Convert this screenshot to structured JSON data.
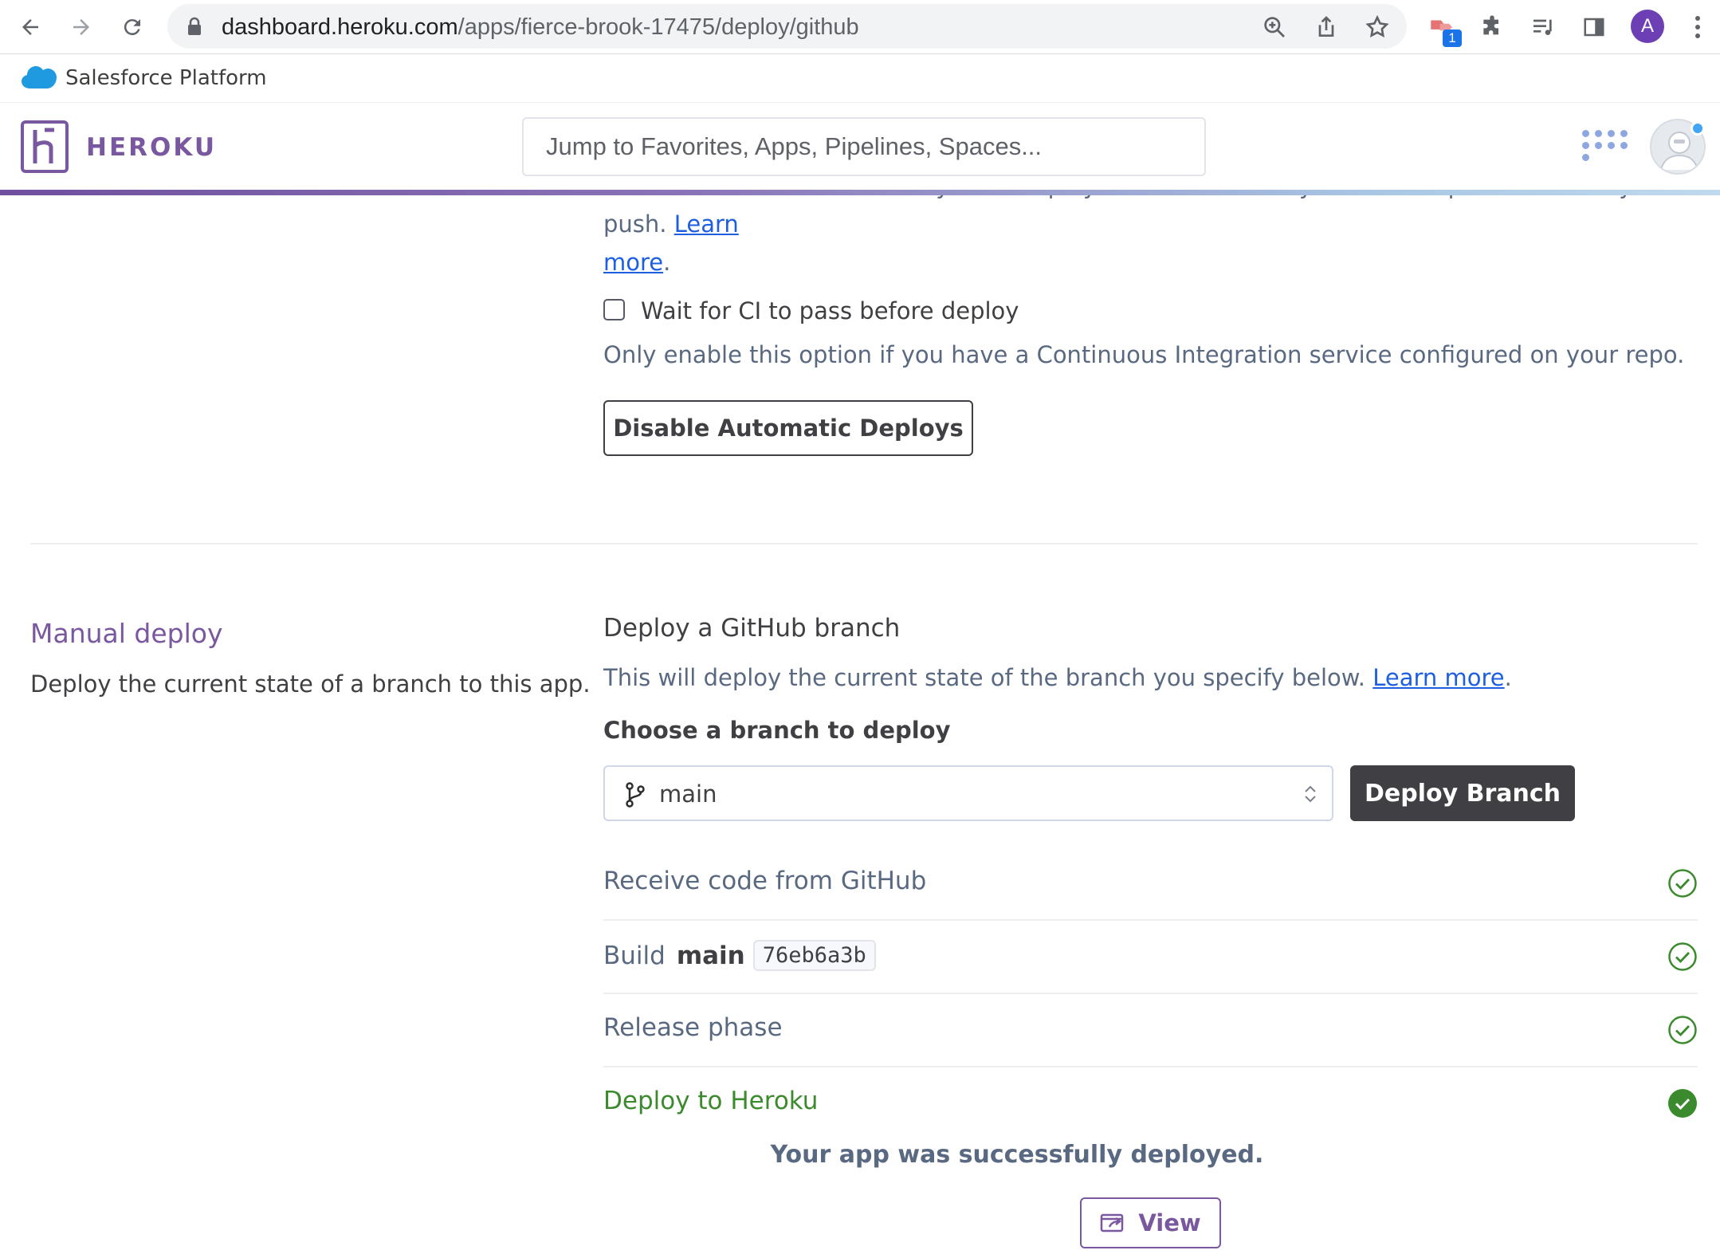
{
  "browser": {
    "url_host": "dashboard.heroku.com",
    "url_path": "/apps/fierce-brook-17475/deploy/github",
    "extension_badge": "1",
    "profile_initial": "A"
  },
  "platform_bar": {
    "label": "Salesforce Platform"
  },
  "header": {
    "brand": "HEROKU",
    "search_placeholder": "Jump to Favorites, Apps, Pipelines, Spaces..."
  },
  "auto_deploy": {
    "partial_text": "this branch in GitHub is always in a deployable state and any tests have passed before you push.",
    "learn_more_1": "Learn",
    "learn_more_2": "more",
    "period": ".",
    "ci_checkbox_label": "Wait for CI to pass before deploy",
    "ci_checked": false,
    "ci_help": "Only enable this option if you have a Continuous Integration service configured on your repo.",
    "disable_button": "Disable Automatic Deploys"
  },
  "manual_deploy": {
    "title": "Manual deploy",
    "description": "Deploy the current state of a branch to this app.",
    "heading": "Deploy a GitHub branch",
    "help_text": "This will deploy the current state of the branch you specify below.",
    "learn_more": "Learn more",
    "period": ".",
    "choose_label": "Choose a branch to deploy",
    "branch": "main",
    "deploy_button": "Deploy Branch",
    "steps": [
      {
        "label": "Receive code from GitHub",
        "status": "done"
      },
      {
        "label": "Build",
        "branch": "main",
        "commit": "76eb6a3b",
        "status": "done"
      },
      {
        "label": "Release phase",
        "status": "done"
      },
      {
        "label": "Deploy to Heroku",
        "status": "success"
      }
    ],
    "success_message": "Your app was successfully deployed.",
    "view_button": "View"
  },
  "colors": {
    "heroku_purple": "#79589f",
    "success_green": "#3c8a2e",
    "link_blue": "#1d5fe0",
    "dark_button": "#3f3f44"
  }
}
